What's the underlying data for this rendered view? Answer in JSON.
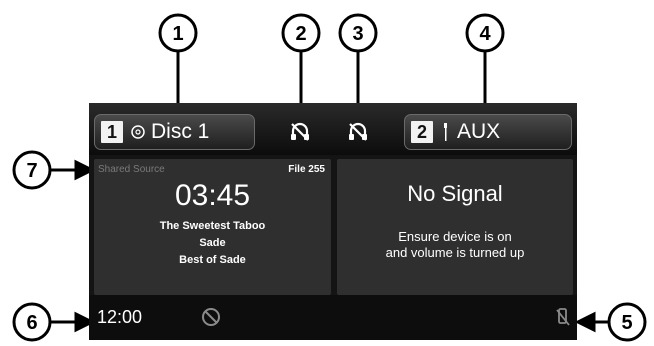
{
  "callouts": [
    "1",
    "2",
    "3",
    "4",
    "5",
    "6",
    "7"
  ],
  "source_left": {
    "number": "1",
    "label": "Disc 1",
    "icon": "disc-icon"
  },
  "source_right": {
    "number": "2",
    "label": "AUX",
    "icon": "aux-icon"
  },
  "status_icons": [
    "bluetooth-audio-off-icon",
    "bluetooth-audio-off-icon"
  ],
  "left_panel": {
    "shared_source": "Shared Source",
    "file": "File 255",
    "time": "03:45",
    "track": "The Sweetest Taboo",
    "artist": "Sade",
    "album": "Best of Sade"
  },
  "right_panel": {
    "title": "No Signal",
    "message_line1": "Ensure device is on",
    "message_line2": "and volume is turned up"
  },
  "bottom": {
    "clock": "12:00",
    "icons": [
      "no-entry-icon",
      "phone-off-icon"
    ]
  }
}
